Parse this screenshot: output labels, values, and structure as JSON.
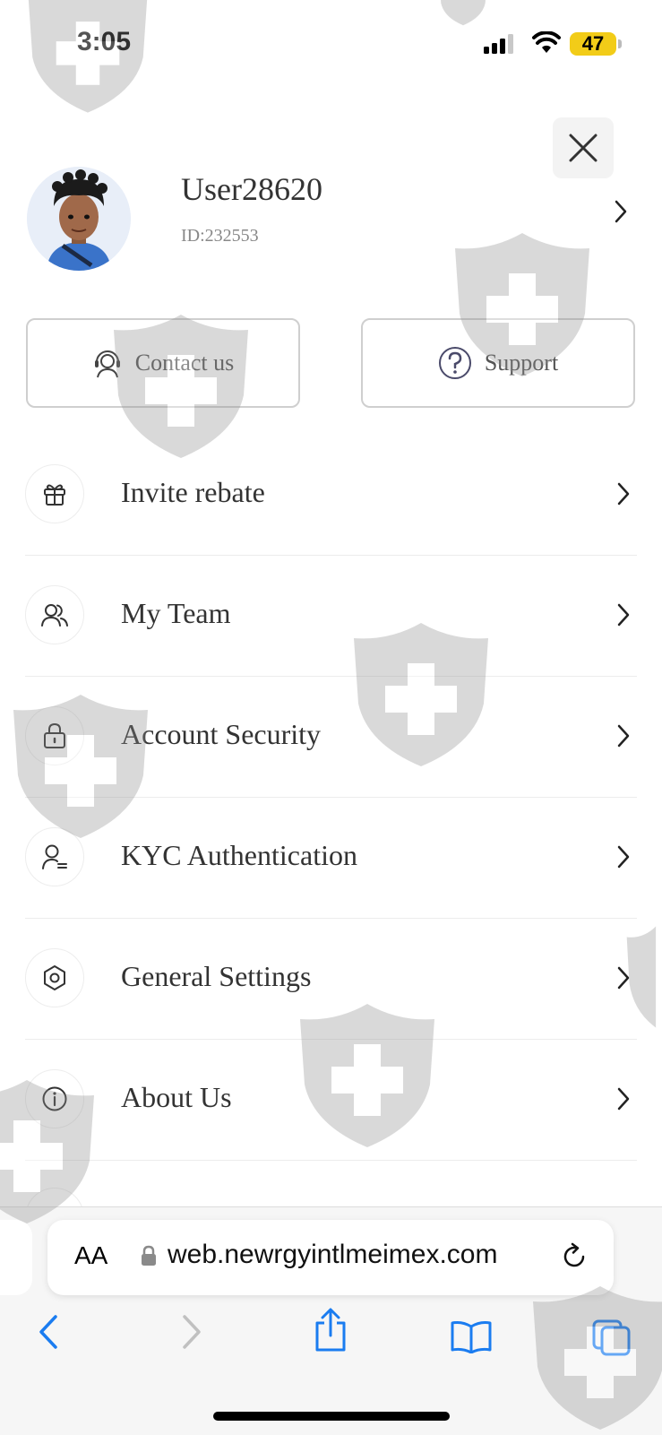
{
  "status_bar": {
    "time": "3:05",
    "battery": "47"
  },
  "profile": {
    "username": "User28620",
    "user_id": "ID:232553"
  },
  "actions": {
    "contact_label": "Contact us",
    "support_label": "Support"
  },
  "menu": [
    {
      "label": "Invite rebate",
      "icon": "gift-icon"
    },
    {
      "label": "My Team",
      "icon": "team-icon"
    },
    {
      "label": "Account Security",
      "icon": "lock-icon"
    },
    {
      "label": "KYC Authentication",
      "icon": "user-id-icon"
    },
    {
      "label": "General Settings",
      "icon": "settings-icon"
    },
    {
      "label": "About Us",
      "icon": "info-icon"
    }
  ],
  "browser": {
    "text_size_label": "AA",
    "url": "web.newrgyintlmeimex.com"
  },
  "colors": {
    "accent_blue": "#1a7cf0",
    "battery_yellow": "#f2cc18",
    "watermark_gray": "#999999"
  }
}
